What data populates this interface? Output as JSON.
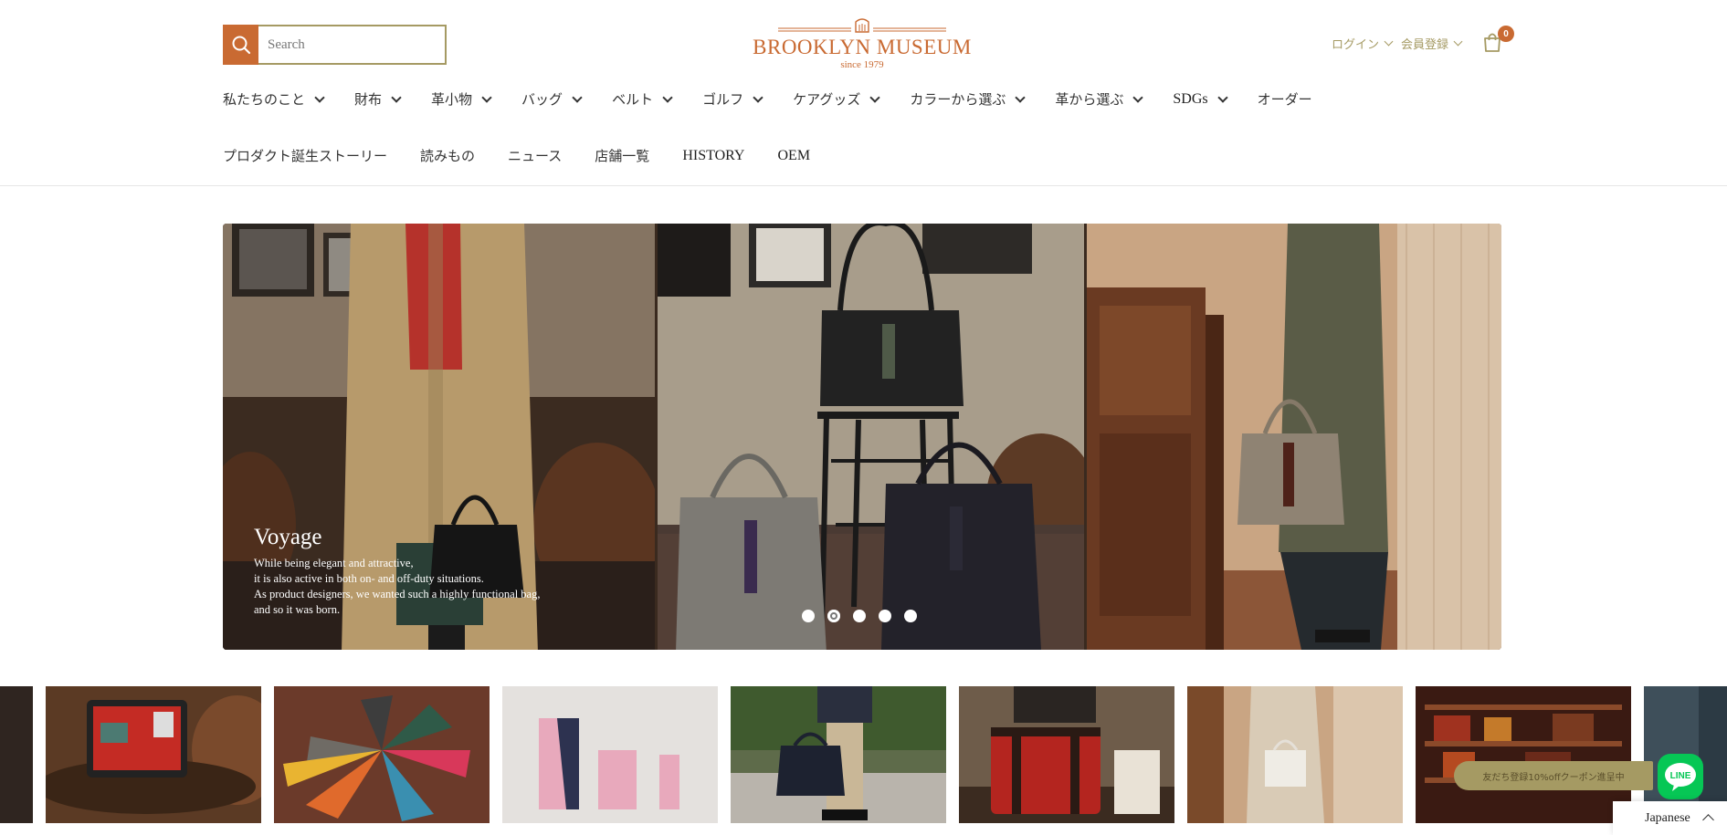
{
  "search": {
    "placeholder": "Search"
  },
  "logo": {
    "brand": "BROOKLYN MUSEUM",
    "since": "since 1979"
  },
  "account": {
    "login": "ログイン",
    "register": "会員登録",
    "cart_count": "0"
  },
  "nav": {
    "row1": [
      {
        "label": "私たちのこと",
        "dropdown": true
      },
      {
        "label": "財布",
        "dropdown": true
      },
      {
        "label": "革小物",
        "dropdown": true
      },
      {
        "label": "バッグ",
        "dropdown": true
      },
      {
        "label": "ベルト",
        "dropdown": true
      },
      {
        "label": "ゴルフ",
        "dropdown": true
      },
      {
        "label": "ケアグッズ",
        "dropdown": true
      },
      {
        "label": "カラーから選ぶ",
        "dropdown": true
      },
      {
        "label": "革から選ぶ",
        "dropdown": true
      },
      {
        "label": "SDGs",
        "dropdown": true
      },
      {
        "label": "オーダー",
        "dropdown": false
      }
    ],
    "row2": [
      {
        "label": "プロダクト誕生ストーリー"
      },
      {
        "label": "読みもの"
      },
      {
        "label": "ニュース"
      },
      {
        "label": "店舗一覧"
      },
      {
        "label": "HISTORY"
      },
      {
        "label": "OEM"
      }
    ]
  },
  "hero": {
    "title": "Voyage",
    "body": "While being elegant and attractive,\nit is also active in both on- and off-duty situations.\nAs product designers, we wanted such a highly functional bag,\nand so it was born.",
    "slide_count": 5,
    "active_slide": 2
  },
  "line_widget": {
    "pill_text": "友だち登録10%offクーポン進呈中"
  },
  "language": {
    "selected": "Japanese"
  },
  "colors": {
    "accent": "#c96a32",
    "gold": "#a59a63",
    "line_green": "#06c755"
  }
}
